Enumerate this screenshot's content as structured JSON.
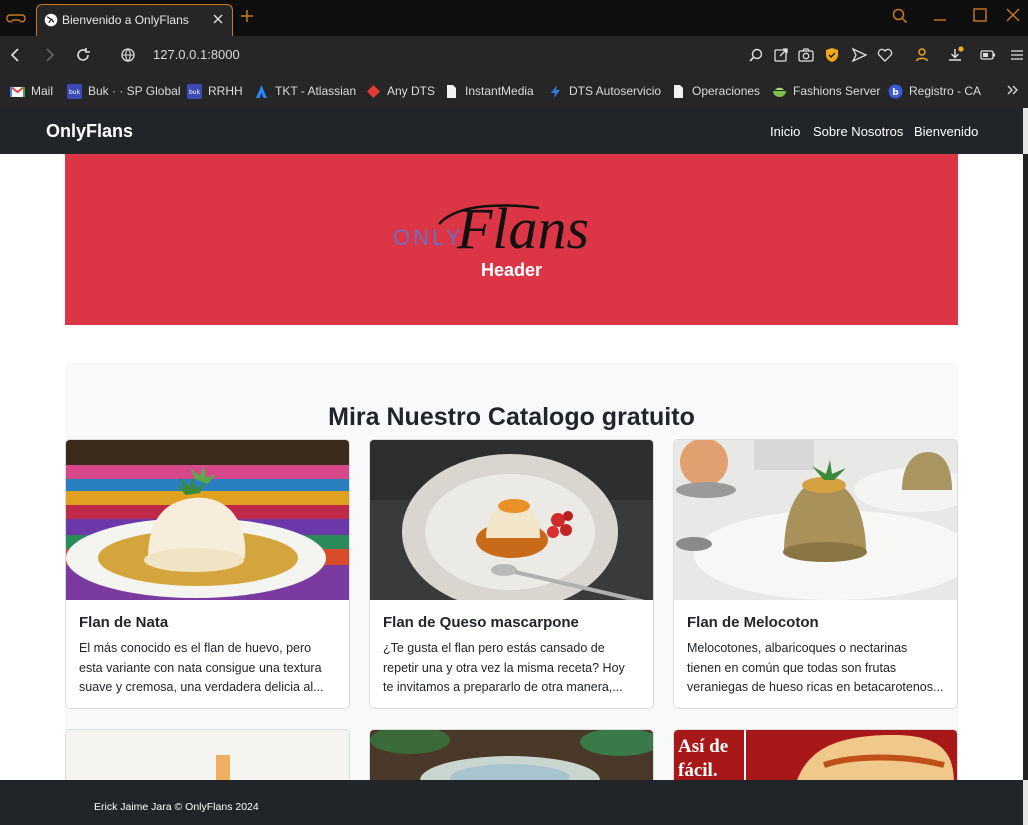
{
  "browser": {
    "tab_title": "Bienvenido a OnlyFlans",
    "url": "127.0.0.1:8000",
    "bookmarks": [
      {
        "label": "Mail",
        "icon": "gmail-icon"
      },
      {
        "label": "Buk · · SP Global",
        "icon": "buk-icon"
      },
      {
        "label": "RRHH",
        "icon": "buk-icon"
      },
      {
        "label": "TKT - Atlassian",
        "icon": "atlassian-icon"
      },
      {
        "label": "Any DTS",
        "icon": "diamond-icon"
      },
      {
        "label": "InstantMedia",
        "icon": "page-icon"
      },
      {
        "label": "DTS Autoservicio",
        "icon": "bolt-icon"
      },
      {
        "label": "Operaciones",
        "icon": "page-icon"
      },
      {
        "label": "Fashions Server",
        "icon": "bowl-icon"
      },
      {
        "label": "Registro - CA",
        "icon": "b-icon"
      }
    ],
    "accent": "#c97a1c"
  },
  "navbar": {
    "brand": "OnlyFlans",
    "links": [
      "Inicio",
      "Sobre Nosotros",
      "Bienvenido"
    ]
  },
  "hero": {
    "logo_only": "ONLY",
    "logo_flans": "Flans",
    "caption": "Header",
    "background": "#dc3545"
  },
  "catalog": {
    "title": "Mira Nuestro Catalogo gratuito",
    "cards": [
      {
        "title": "Flan de Nata",
        "text": [
          "El más conocido es el flan de huevo, pero",
          "esta variante con nata consigue una textura",
          "suave y cremosa, una verdadera delicia al..."
        ]
      },
      {
        "title": "Flan de Queso mascarpone",
        "text": [
          "¿Te gusta el flan pero estás cansado de",
          "repetir una y otra vez la misma receta? Hoy",
          "te invitamos a prepararlo de otra manera,..."
        ]
      },
      {
        "title": "Flan de Melocoton",
        "text": [
          "Melocotones, albaricoques o nectarinas",
          "tienen en común que todas son frutas",
          "veraniegas de hueso ricas en betacarotenos..."
        ]
      }
    ],
    "partial_card_text": "Así de fácil."
  },
  "footer": {
    "text": "Erick Jaime Jara © OnlyFlans 2024"
  }
}
